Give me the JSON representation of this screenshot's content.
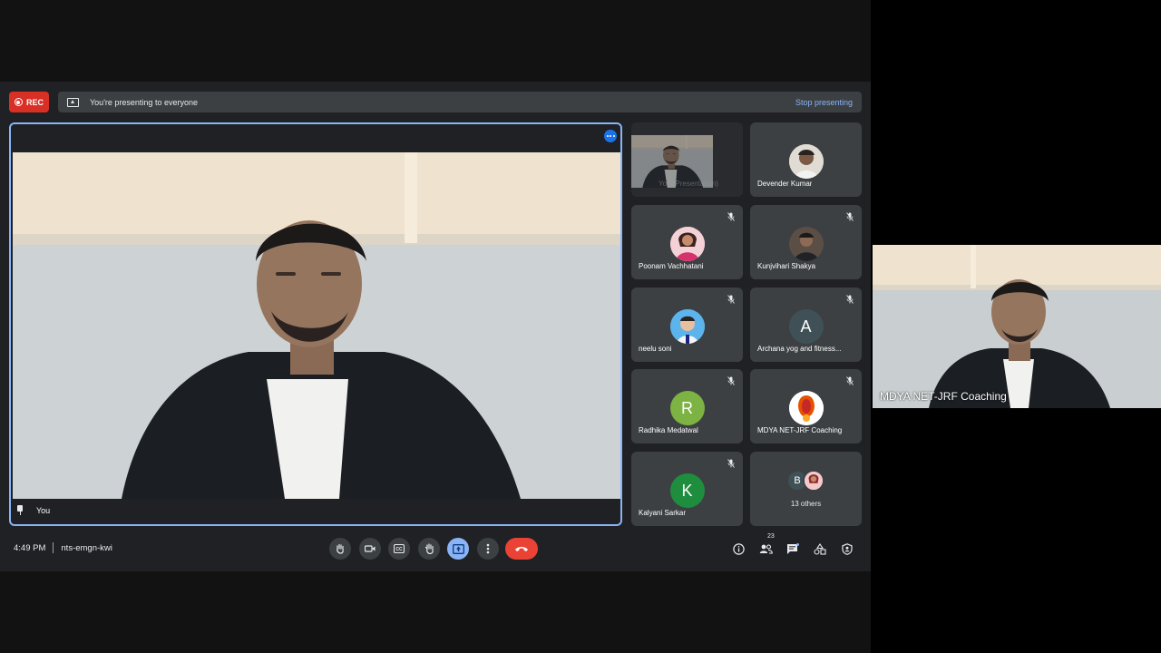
{
  "recording": {
    "label": "REC"
  },
  "presenting_bar": {
    "message": "You're presenting to everyone",
    "stop_label": "Stop presenting"
  },
  "main_tile": {
    "name": "You"
  },
  "participants": [
    {
      "name": "You (Presentation)",
      "type": "self-presentation"
    },
    {
      "name": "Devender Kumar",
      "avatar": "photo",
      "muted": false
    },
    {
      "name": "Poonam Vachhatani",
      "avatar": "photo",
      "muted": true
    },
    {
      "name": "Kunjvihari Shakya",
      "avatar": "photo",
      "muted": true
    },
    {
      "name": "neelu soni",
      "avatar": "photo",
      "muted": true
    },
    {
      "name": "Archana yog and fitness...",
      "avatar_letter": "A",
      "avatar_color": "#3f5157",
      "muted": true
    },
    {
      "name": "Radhika Medatwal",
      "avatar_letter": "R",
      "avatar_color": "#7cb342",
      "muted": true
    },
    {
      "name": "MDYA NET-JRF Coaching",
      "avatar": "logo",
      "muted": true
    },
    {
      "name": "Kalyani Sarkar",
      "avatar_letter": "K",
      "avatar_color": "#1e8e3e",
      "muted": true
    }
  ],
  "others": {
    "label": "13 others",
    "avatar_letter": "B"
  },
  "meeting": {
    "time": "4:49 PM",
    "code": "nts-emgn-kwi"
  },
  "people_count": "23",
  "controls": [
    "raise-hand",
    "camera",
    "captions",
    "reactions",
    "present",
    "more",
    "leave"
  ],
  "pip": {
    "name": "MDYA NET-JRF Coaching"
  },
  "colors": {
    "accent": "#8ab4f8",
    "danger": "#ea4335",
    "surface": "#202124",
    "tile": "#3c4043"
  }
}
